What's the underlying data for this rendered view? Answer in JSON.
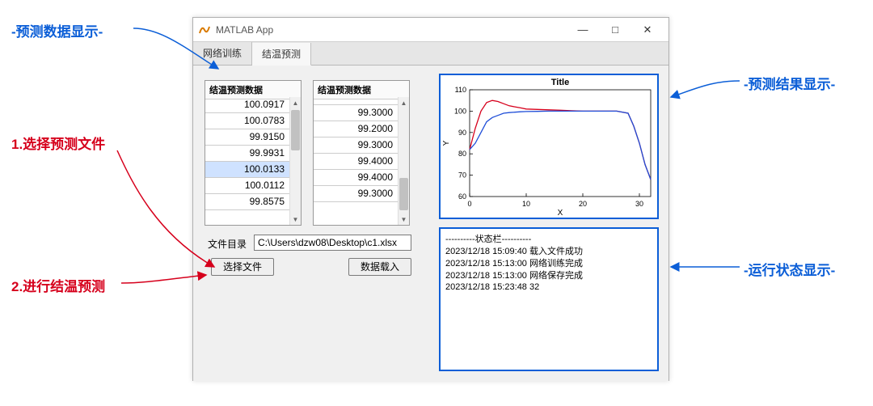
{
  "annotations": {
    "top_left": "-预测数据显示-",
    "step1": "1.选择预测文件",
    "step2": "2.进行结温预测",
    "top_right": "-预测结果显示-",
    "bottom_right": "-运行状态显示-"
  },
  "window": {
    "title": "MATLAB App",
    "min": "—",
    "max": "□",
    "close": "✕"
  },
  "tabs": [
    "网络训练",
    "结温预测"
  ],
  "active_tab": 1,
  "tables": {
    "header1": "结温预测数据",
    "header2": "结温预测数据",
    "col1": [
      "100.0917",
      "100.0783",
      "99.9150",
      "99.9931",
      "100.0133",
      "100.0112",
      "99.8575"
    ],
    "col2": [
      "99.3000",
      "99.2000",
      "99.3000",
      "99.4000",
      "99.4000",
      "99.3000"
    ]
  },
  "fileline": {
    "label": "文件目录",
    "value": "C:\\Users\\dzw08\\Desktop\\c1.xlsx"
  },
  "buttons": {
    "choose": "选择文件",
    "load": "数据载入"
  },
  "chart": {
    "title": "Title",
    "xlabel": "X",
    "ylabel": "Y"
  },
  "chart_data": {
    "type": "line",
    "xlim": [
      0,
      32
    ],
    "ylim": [
      60,
      110
    ],
    "xticks": [
      0,
      10,
      20,
      30
    ],
    "yticks": [
      60,
      70,
      80,
      90,
      100,
      110
    ],
    "series": [
      {
        "name": "series-red",
        "color": "#d6001c",
        "x": [
          0,
          1,
          2,
          3,
          4,
          5,
          6,
          7,
          8,
          9,
          10,
          12,
          14,
          16,
          18,
          20,
          22,
          24,
          26,
          28,
          29,
          30,
          31,
          32
        ],
        "y": [
          82,
          92,
          100,
          104,
          105,
          104.5,
          103.5,
          102.5,
          102,
          101.5,
          101,
          100.8,
          100.6,
          100.4,
          100.2,
          100,
          100,
          100,
          100,
          99,
          93,
          85,
          75,
          68
        ]
      },
      {
        "name": "series-blue",
        "color": "#1f4ed8",
        "x": [
          0,
          1,
          2,
          3,
          4,
          5,
          6,
          7,
          8,
          9,
          10,
          12,
          14,
          16,
          18,
          20,
          22,
          24,
          26,
          28,
          29,
          30,
          31,
          32
        ],
        "y": [
          82,
          85,
          90,
          95,
          97,
          98,
          99,
          99.3,
          99.5,
          99.7,
          99.8,
          99.9,
          100,
          100,
          100,
          100,
          100,
          100,
          100,
          99,
          93,
          85,
          75,
          68
        ]
      }
    ],
    "title": "Title",
    "xlabel": "X",
    "ylabel": "Y"
  },
  "status": {
    "header": "----------状态栏----------",
    "lines": [
      "2023/12/18 15:09:40 载入文件成功",
      "2023/12/18 15:13:00 网络训练完成",
      "2023/12/18 15:13:00 网络保存完成",
      "2023/12/18 15:23:48 32"
    ]
  }
}
